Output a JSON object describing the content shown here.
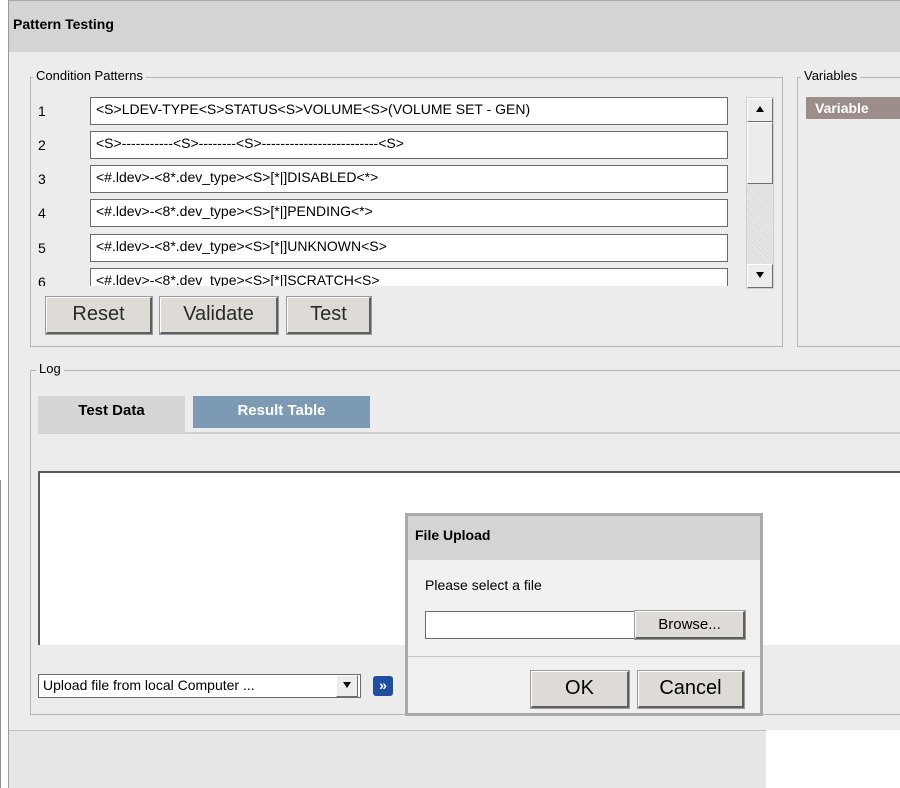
{
  "window": {
    "title": "Pattern Testing"
  },
  "condition_patterns": {
    "legend": "Condition Patterns",
    "rows": [
      {
        "num": "1",
        "value": "<S>LDEV-TYPE<S>STATUS<S>VOLUME<S>(VOLUME SET - GEN)"
      },
      {
        "num": "2",
        "value": "<S>-----------<S>--------<S>-------------------------<S>"
      },
      {
        "num": "3",
        "value": "<#.ldev>-<8*.dev_type><S>[*|]DISABLED<*>"
      },
      {
        "num": "4",
        "value": "<#.ldev>-<8*.dev_type><S>[*|]PENDING<*>"
      },
      {
        "num": "5",
        "value": "<#.ldev>-<8*.dev_type><S>[*|]UNKNOWN<S>"
      },
      {
        "num": "6",
        "value": "<#.ldev>-<8*.dev_type><S>[*|]SCRATCH<S>"
      }
    ],
    "buttons": {
      "reset": "Reset",
      "validate": "Validate",
      "test": "Test"
    }
  },
  "variables": {
    "legend": "Variables",
    "column_header": "Variable"
  },
  "log": {
    "legend": "Log",
    "tabs": [
      {
        "label": "Test Data",
        "active": true
      },
      {
        "label": "Result Table",
        "active": false
      }
    ],
    "upload_select": "Upload file from local Computer ...",
    "go_icon": "double-chevron-right-icon"
  },
  "file_upload_dialog": {
    "title": "File Upload",
    "message": "Please select a file",
    "file_value": "",
    "browse_label": "Browse...",
    "ok_label": "OK",
    "cancel_label": "Cancel"
  },
  "colors": {
    "tab_inactive": "#7c9ab4",
    "variable_header": "#9b8e8a",
    "go_button": "#1f4f9e"
  }
}
